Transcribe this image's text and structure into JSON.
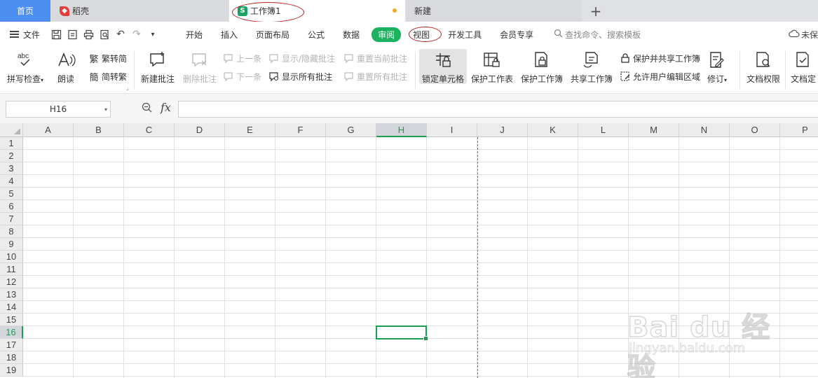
{
  "tabs": {
    "home": "首页",
    "daoke": "稻壳",
    "workbook": "工作簿1",
    "new": "新建",
    "plus": "+"
  },
  "menu": {
    "file": "文件",
    "tabs": [
      "开始",
      "插入",
      "页面布局",
      "公式",
      "数据",
      "审阅",
      "视图",
      "开发工具",
      "会员专享"
    ],
    "active_tab": "审阅",
    "search": "查找命令、搜索模板",
    "right_label": "未保"
  },
  "ribbon": {
    "spell_check": "拼写检查",
    "read_aloud": "朗读",
    "trad_to_simp": "繁转简",
    "simp_to_trad": "简转繁",
    "new_comment": "新建批注",
    "delete_comment": "删除批注",
    "prev_item": "上一条",
    "next_item": "下一条",
    "show_hide_comments": "显示/隐藏批注",
    "show_all_comments": "显示所有批注",
    "reset_current_comment": "重置当前批注",
    "reset_all_comments": "重置所有批注",
    "lock_cell": "锁定单元格",
    "protect_sheet": "保护工作表",
    "protect_workbook": "保护工作簿",
    "share_workbook": "共享工作簿",
    "protect_and_share": "保护并共享工作簿",
    "allow_edit_ranges": "允许用户编辑区域",
    "revise": "修订",
    "doc_permission": "文档权限",
    "doc_finalize": "文档定"
  },
  "formula_bar": {
    "name_box": "H16",
    "fx_label": "fx",
    "value": ""
  },
  "grid": {
    "columns": [
      "A",
      "B",
      "C",
      "D",
      "E",
      "F",
      "G",
      "H",
      "I",
      "J",
      "K",
      "L",
      "M",
      "N",
      "O",
      "P"
    ],
    "rows": [
      "1",
      "2",
      "3",
      "4",
      "5",
      "6",
      "7",
      "8",
      "9",
      "10",
      "11",
      "12",
      "13",
      "14",
      "15",
      "16",
      "17",
      "18",
      "19"
    ],
    "selected_column": "H",
    "selected_row": "16"
  },
  "watermark": {
    "brand": "Bai du 经验",
    "url": "jingyan.baidu.com"
  },
  "colors": {
    "accent_green": "#1a9e54",
    "home_tab_blue": "#4d8ff0",
    "annotation_red": "#b71c1c"
  }
}
